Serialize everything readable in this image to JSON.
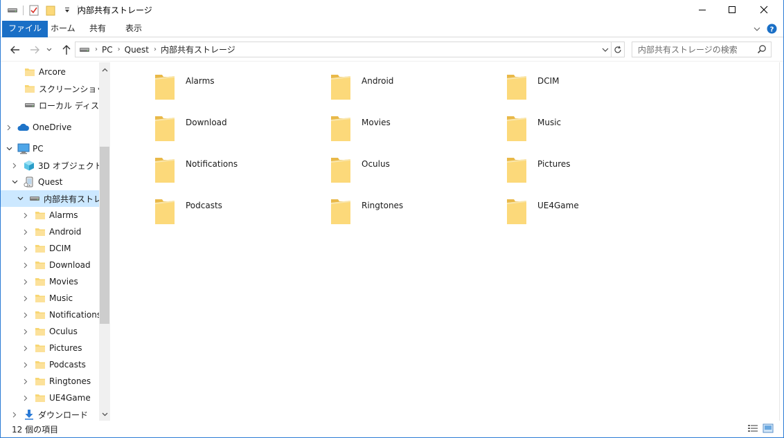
{
  "window": {
    "title": "内部共有ストレージ",
    "accent": "#1a6fc6"
  },
  "ribbon": {
    "tabs": [
      "ファイル",
      "ホーム",
      "共有",
      "表示"
    ]
  },
  "address": {
    "crumbs": [
      "PC",
      "Quest",
      "内部共有ストレージ"
    ]
  },
  "search": {
    "placeholder": "内部共有ストレージの検索"
  },
  "navpane": {
    "items": [
      {
        "label": "Arcore",
        "icon": "folder-icon"
      },
      {
        "label": "スクリーンショット",
        "icon": "folder-icon"
      },
      {
        "label": "ローカル ディスク (E",
        "icon": "drive-icon"
      },
      {
        "label": "OneDrive",
        "icon": "cloud-icon"
      },
      {
        "label": "PC",
        "icon": "pc-icon"
      },
      {
        "label": "3D オブジェクト",
        "icon": "cube-icon"
      },
      {
        "label": "Quest",
        "icon": "device-icon"
      },
      {
        "label": "内部共有ストレ-",
        "icon": "drive-icon"
      },
      {
        "label": "Alarms",
        "icon": "folder-icon"
      },
      {
        "label": "Android",
        "icon": "folder-icon"
      },
      {
        "label": "DCIM",
        "icon": "folder-icon"
      },
      {
        "label": "Download",
        "icon": "folder-icon"
      },
      {
        "label": "Movies",
        "icon": "folder-icon"
      },
      {
        "label": "Music",
        "icon": "folder-icon"
      },
      {
        "label": "Notifications",
        "icon": "folder-icon"
      },
      {
        "label": "Oculus",
        "icon": "folder-icon"
      },
      {
        "label": "Pictures",
        "icon": "folder-icon"
      },
      {
        "label": "Podcasts",
        "icon": "folder-icon"
      },
      {
        "label": "Ringtones",
        "icon": "folder-icon"
      },
      {
        "label": "UE4Game",
        "icon": "folder-icon"
      },
      {
        "label": "ダウンロード",
        "icon": "download-icon"
      }
    ]
  },
  "content": {
    "folders": [
      "Alarms",
      "Android",
      "DCIM",
      "Download",
      "Movies",
      "Music",
      "Notifications",
      "Oculus",
      "Pictures",
      "Podcasts",
      "Ringtones",
      "UE4Game"
    ]
  },
  "status": {
    "count": "12 個の項目"
  }
}
